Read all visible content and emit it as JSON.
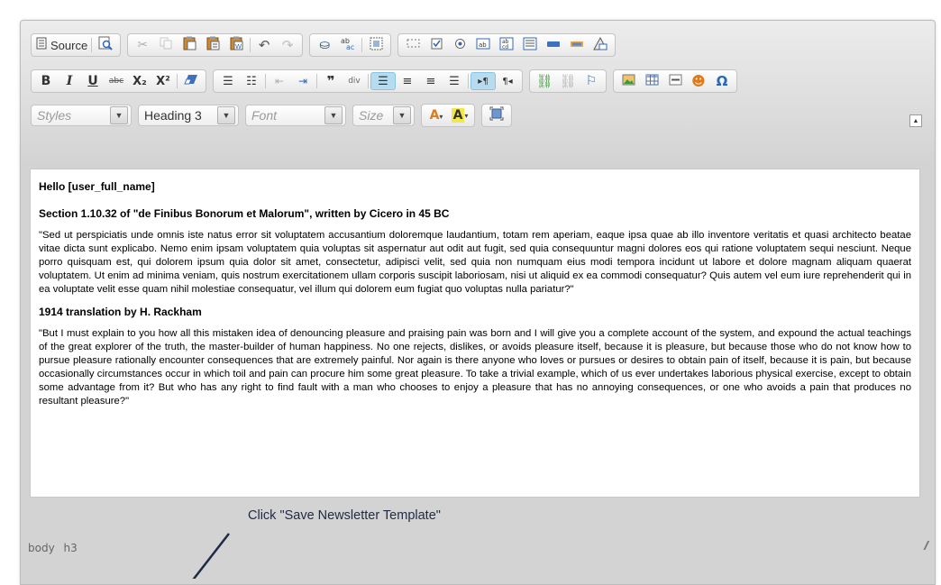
{
  "toolbar": {
    "row1": {
      "source_label": "Source",
      "groups": [
        [
          {
            "name": "source-button",
            "icon": "source-document-icon",
            "label": true
          },
          {
            "name": "preview-button",
            "icon": "preview-magnifier-icon"
          }
        ],
        [
          {
            "name": "cut-button",
            "icon": "scissors-icon",
            "disabled": true
          },
          {
            "name": "copy-button",
            "icon": "copy-icon",
            "disabled": true
          },
          {
            "name": "paste-button",
            "icon": "paste-clipboard-icon"
          },
          {
            "name": "paste-text-button",
            "icon": "paste-text-icon"
          },
          {
            "name": "paste-word-button",
            "icon": "paste-word-icon"
          },
          {
            "name": "undo-button",
            "icon": "undo-arrow-icon"
          },
          {
            "name": "redo-button",
            "icon": "redo-arrow-icon",
            "disabled": true
          }
        ],
        [
          {
            "name": "find-button",
            "icon": "binoculars-icon"
          },
          {
            "name": "replace-button",
            "icon": "replace-icon"
          },
          {
            "name": "select-all-button",
            "icon": "select-all-icon"
          }
        ],
        [
          {
            "name": "form-button",
            "icon": "form-icon"
          },
          {
            "name": "checkbox-button",
            "icon": "checkbox-icon"
          },
          {
            "name": "radio-button",
            "icon": "radio-icon"
          },
          {
            "name": "textfield-button",
            "icon": "textfield-icon"
          },
          {
            "name": "textarea-button",
            "icon": "textarea-icon"
          },
          {
            "name": "select-field-button",
            "icon": "select-field-icon"
          },
          {
            "name": "form-button-button",
            "icon": "button-icon"
          },
          {
            "name": "image-button-button",
            "icon": "image-button-icon"
          },
          {
            "name": "hidden-field-button",
            "icon": "hidden-field-icon"
          }
        ]
      ]
    },
    "row2": {
      "bold": "B",
      "italic": "I",
      "underline": "U",
      "strike": "abc",
      "subscript": "X₂",
      "superscript": "X²"
    },
    "row3": {
      "styles_placeholder": "Styles",
      "format_value": "Heading 3",
      "font_placeholder": "Font",
      "size_placeholder": "Size"
    }
  },
  "content": {
    "greeting": "Hello [user_full_name]",
    "section_title": "Section 1.10.32 of \"de Finibus Bonorum et Malorum\", written by Cicero in 45 BC",
    "paragraph1": "\"Sed ut perspiciatis unde omnis iste natus error sit voluptatem accusantium doloremque laudantium, totam rem aperiam, eaque ipsa quae ab illo inventore veritatis et quasi architecto beatae vitae dicta sunt explicabo. Nemo enim ipsam voluptatem quia voluptas sit aspernatur aut odit aut fugit, sed quia consequuntur magni dolores eos qui ratione voluptatem sequi nesciunt. Neque porro quisquam est, qui dolorem ipsum quia dolor sit amet, consectetur, adipisci velit, sed quia non numquam eius modi tempora incidunt ut labore et dolore magnam aliquam quaerat voluptatem. Ut enim ad minima veniam, quis nostrum exercitationem ullam corporis suscipit laboriosam, nisi ut aliquid ex ea commodi consequatur? Quis autem vel eum iure reprehenderit qui in ea voluptate velit esse quam nihil molestiae consequatur, vel illum qui dolorem eum fugiat quo voluptas nulla pariatur?\"",
    "translation_title": "1914 translation by H. Rackham",
    "paragraph2": "\"But I must explain to you how all this mistaken idea of denouncing pleasure and praising pain was born and I will give you a complete account of the system, and expound the actual teachings of the great explorer of the truth, the master-builder of human happiness. No one rejects, dislikes, or avoids pleasure itself, because it is pleasure, but because those who do not know how to pursue pleasure rationally encounter consequences that are extremely painful. Nor again is there anyone who loves or pursues or desires to obtain pain of itself, because it is pain, but because occasionally circumstances occur in which toil and pain can procure him some great pleasure. To take a trivial example, which of us ever undertakes laborious physical exercise, except to obtain some advantage from it? But who has any right to find fault with a man who chooses to enjoy a pleasure that has no annoying consequences, or one who avoids a pain that produces no resultant pleasure?\""
  },
  "elementspath": {
    "items": [
      "body",
      "h3"
    ]
  },
  "annotation": {
    "text": "Click \"Save Newsletter Template\"",
    "color": "#1f2a44"
  }
}
